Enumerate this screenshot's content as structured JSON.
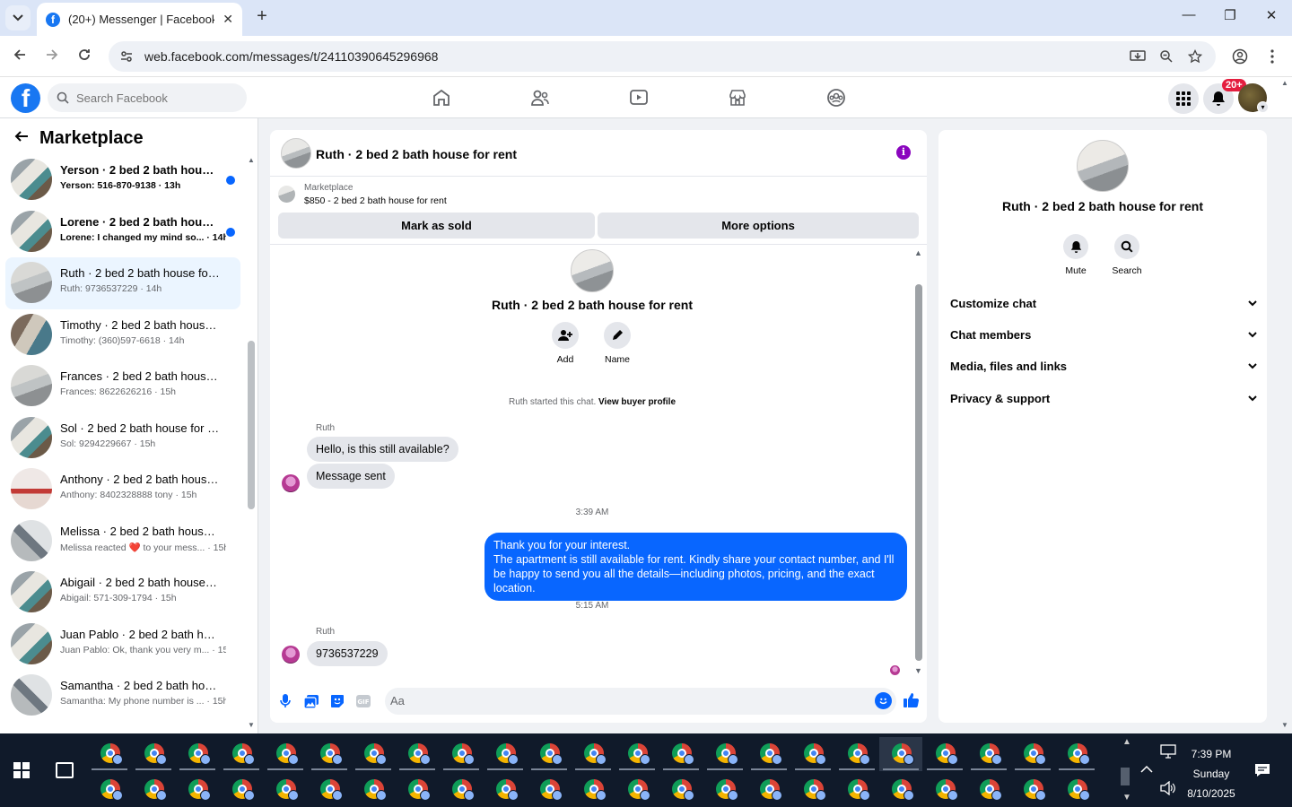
{
  "browser": {
    "tab_title": "(20+) Messenger | Facebook",
    "url": "web.facebook.com/messages/t/24110390645296968"
  },
  "facebook": {
    "search_placeholder": "Search Facebook",
    "notif_count": "20+"
  },
  "sidebar": {
    "title": "Marketplace",
    "conversations": [
      {
        "title": "Yerson · 2 bed 2 bath house f...",
        "subtitle": "Yerson: 516-870-9138 · 13h",
        "unread": true,
        "thumb": "t1"
      },
      {
        "title": "Lorene · 2 bed 2 bath house f...",
        "subtitle": "Lorene: I changed my mind so... · 14h",
        "unread": true,
        "thumb": "t1"
      },
      {
        "title": "Ruth · 2 bed 2 bath house for re...",
        "subtitle": "Ruth: 9736537229 · 14h",
        "unread": false,
        "active": true,
        "thumb": "t2"
      },
      {
        "title": "Timothy · 2 bed 2 bath house f...",
        "subtitle": "Timothy: (360)597-6618 · 14h",
        "unread": false,
        "thumb": "t3"
      },
      {
        "title": "Frances · 2 bed 2 bath house fo...",
        "subtitle": "Frances: 8622626216 · 15h",
        "unread": false,
        "thumb": "t2"
      },
      {
        "title": "Sol · 2 bed 2 bath house for rent",
        "subtitle": "Sol: 9294229667 · 15h",
        "unread": false,
        "thumb": "t1"
      },
      {
        "title": "Anthony · 2 bed 2 bath house f...",
        "subtitle": "Anthony: 8402328888 tony · 15h",
        "unread": false,
        "thumb": "t4"
      },
      {
        "title": "Melissa · 2 bed 2 bath house for...",
        "subtitle": "Melissa reacted ❤️ to your mess... · 15h",
        "unread": false,
        "thumb": "t5"
      },
      {
        "title": "Abigail · 2 bed 2 bath house for...",
        "subtitle": "Abigail: 571-309-1794 · 15h",
        "unread": false,
        "thumb": "t1"
      },
      {
        "title": "Juan Pablo · 2 bed 2 bath house...",
        "subtitle": "Juan Pablo: Ok, thank you very m... · 15h",
        "unread": false,
        "thumb": "t1"
      },
      {
        "title": "Samantha · 2 bed 2 bath house ...",
        "subtitle": "Samantha: My phone number is ... · 15h",
        "unread": false,
        "thumb": "t5"
      }
    ]
  },
  "chat": {
    "title": "Ruth · 2 bed 2 bath house for rent",
    "marketplace_label": "Marketplace",
    "listing": "$850 - 2 bed 2 bath house for rent",
    "mark_sold": "Mark as sold",
    "more_options": "More options",
    "header_name": "Ruth · 2 bed 2 bath house for rent",
    "add_label": "Add",
    "name_label": "Name",
    "started_text": "Ruth started this chat.",
    "view_profile": "View buyer profile",
    "sender": "Ruth",
    "msg1": "Hello, is this still available?",
    "msg2": "Message sent",
    "time1": "3:39 AM",
    "reply_line1": "Thank you for your interest.",
    "reply_line2": "The apartment is still available for rent. Kindly share your contact number, and I'll be happy to send you all the details—including photos, pricing, and the exact location.",
    "time2": "5:15 AM",
    "sender2": "Ruth",
    "msg3": "9736537229",
    "composer_placeholder": "Aa"
  },
  "details": {
    "name": "Ruth · 2 bed 2 bath house for rent",
    "mute": "Mute",
    "search": "Search",
    "sections": [
      "Customize chat",
      "Chat members",
      "Media, files and links",
      "Privacy & support"
    ]
  },
  "taskbar": {
    "time": "7:39 PM",
    "day": "Sunday",
    "date": "8/10/2025"
  },
  "colors": {
    "accent": "#0866ff",
    "fb_blue": "#1877f2",
    "info_purple": "#8a05be"
  }
}
